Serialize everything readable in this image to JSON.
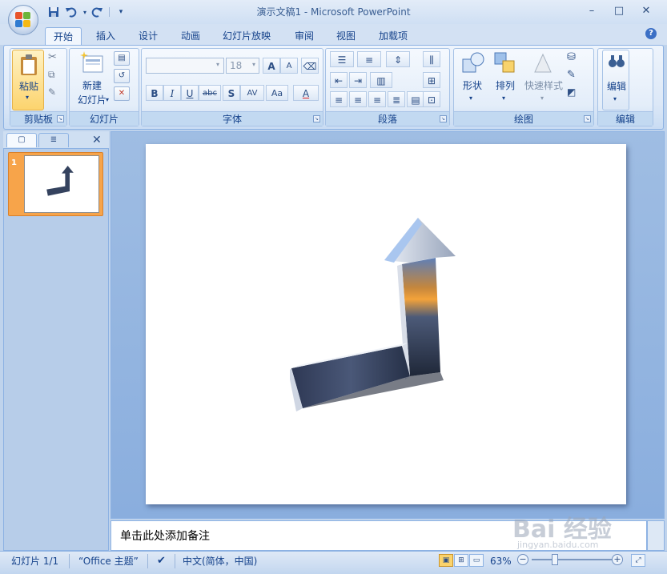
{
  "window": {
    "title": "演示文稿1 - Microsoft PowerPoint",
    "minimize": "–",
    "maximize": "□",
    "close": "✕"
  },
  "qat": {
    "save_icon": "floppy-icon",
    "undo_icon": "undo-icon",
    "redo_icon": "redo-icon",
    "customize_icon": "dropdown-icon"
  },
  "tabs": [
    {
      "label": "开始",
      "active": true
    },
    {
      "label": "插入"
    },
    {
      "label": "设计"
    },
    {
      "label": "动画"
    },
    {
      "label": "幻灯片放映"
    },
    {
      "label": "审阅"
    },
    {
      "label": "视图"
    },
    {
      "label": "加载项"
    }
  ],
  "help": "?",
  "ribbon": {
    "clipboard": {
      "label": "剪贴板",
      "paste": "粘贴"
    },
    "slides": {
      "label": "幻灯片",
      "new_slide_1": "新建",
      "new_slide_2": "幻灯片"
    },
    "font": {
      "label": "字体",
      "font_name": "",
      "font_size": "18",
      "grow": "A",
      "shrink": "A",
      "bold": "B",
      "italic": "I",
      "underline": "U",
      "strike": "abc",
      "shadow": "S",
      "spacing": "AV",
      "case": "Aa",
      "color": "A"
    },
    "paragraph": {
      "label": "段落"
    },
    "drawing": {
      "label": "绘图",
      "shapes": "形状",
      "arrange": "排列",
      "quick_styles": "快速样式"
    },
    "editing": {
      "label": "编辑"
    }
  },
  "slides_panel": {
    "slide_number": "1"
  },
  "notes": {
    "placeholder": "单击此处添加备注"
  },
  "status": {
    "slide_info": "幻灯片 1/1",
    "theme": "“Office 主题”",
    "language": "中文(简体，中国)",
    "zoom": "63%",
    "zoom_minus": "−",
    "zoom_plus": "+"
  },
  "watermark": {
    "brand": "Bai 经验",
    "url": "jingyan.baidu.com"
  },
  "colors": {
    "ribbon_bg": "#dce8f7",
    "accent_orange": "#f7a44a",
    "text_blue": "#15428b"
  }
}
